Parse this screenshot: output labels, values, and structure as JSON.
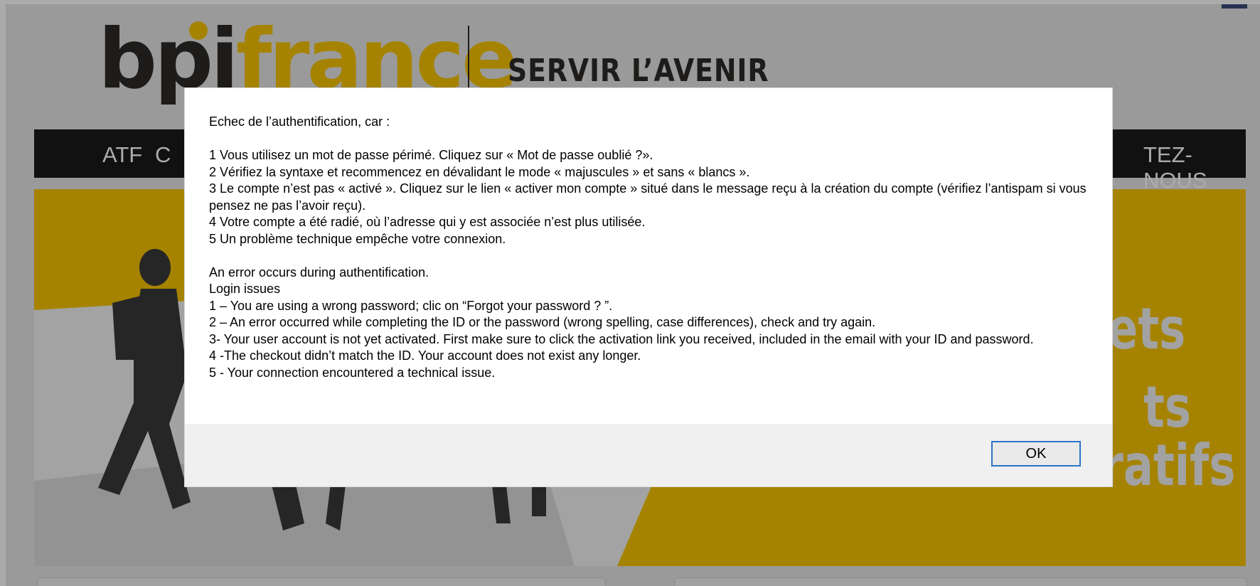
{
  "header": {
    "logo_bpi": "bpi",
    "logo_france": "france",
    "tagline": "SERVIR L’AVENIR"
  },
  "nav": {
    "items": [
      "ATF",
      "C",
      "TEZ-NOUS"
    ]
  },
  "hero": {
    "words": [
      "ets",
      "ts",
      "Collaboratifs"
    ]
  },
  "dialog": {
    "lines_fr": [
      "Echec de l’authentification, car :",
      "",
      "1  Vous utilisez un mot de passe périmé. Cliquez sur « Mot de passe oublié ?».",
      "2  Vérifiez la syntaxe et recommencez en dévalidant le mode « majuscules » et sans « blancs ».",
      "3  Le compte n’est pas « activé ». Cliquez sur le lien « activer mon compte » situé dans le message reçu à la création du compte (vérifiez l’antispam si vous pensez ne pas l’avoir reçu).",
      "4  Votre compte a été radié, où l’adresse qui y est associée n’est plus utilisée.",
      "5  Un problème technique empêche votre connexion.",
      "",
      "An error occurs during authentification.",
      "Login issues",
      "1 – You are using a wrong password; clic on “Forgot your password ? ”.",
      "2 – An error occurred while completing the ID or the password (wrong spelling, case differences), check and try again.",
      "3- Your user account is not yet activated. First make sure to click the activation link you received, included in the email with your ID and password.",
      "4 -The checkout didn’t match the ID. Your account does not exist any longer.",
      "5 - Your connection encountered a technical issue."
    ],
    "ok_label": "OK"
  },
  "colors": {
    "brand_yellow": "#f6c300",
    "brand_dark": "#2e2a27",
    "nav_bg": "#1a1a1a",
    "button_border": "#2a73c9"
  }
}
